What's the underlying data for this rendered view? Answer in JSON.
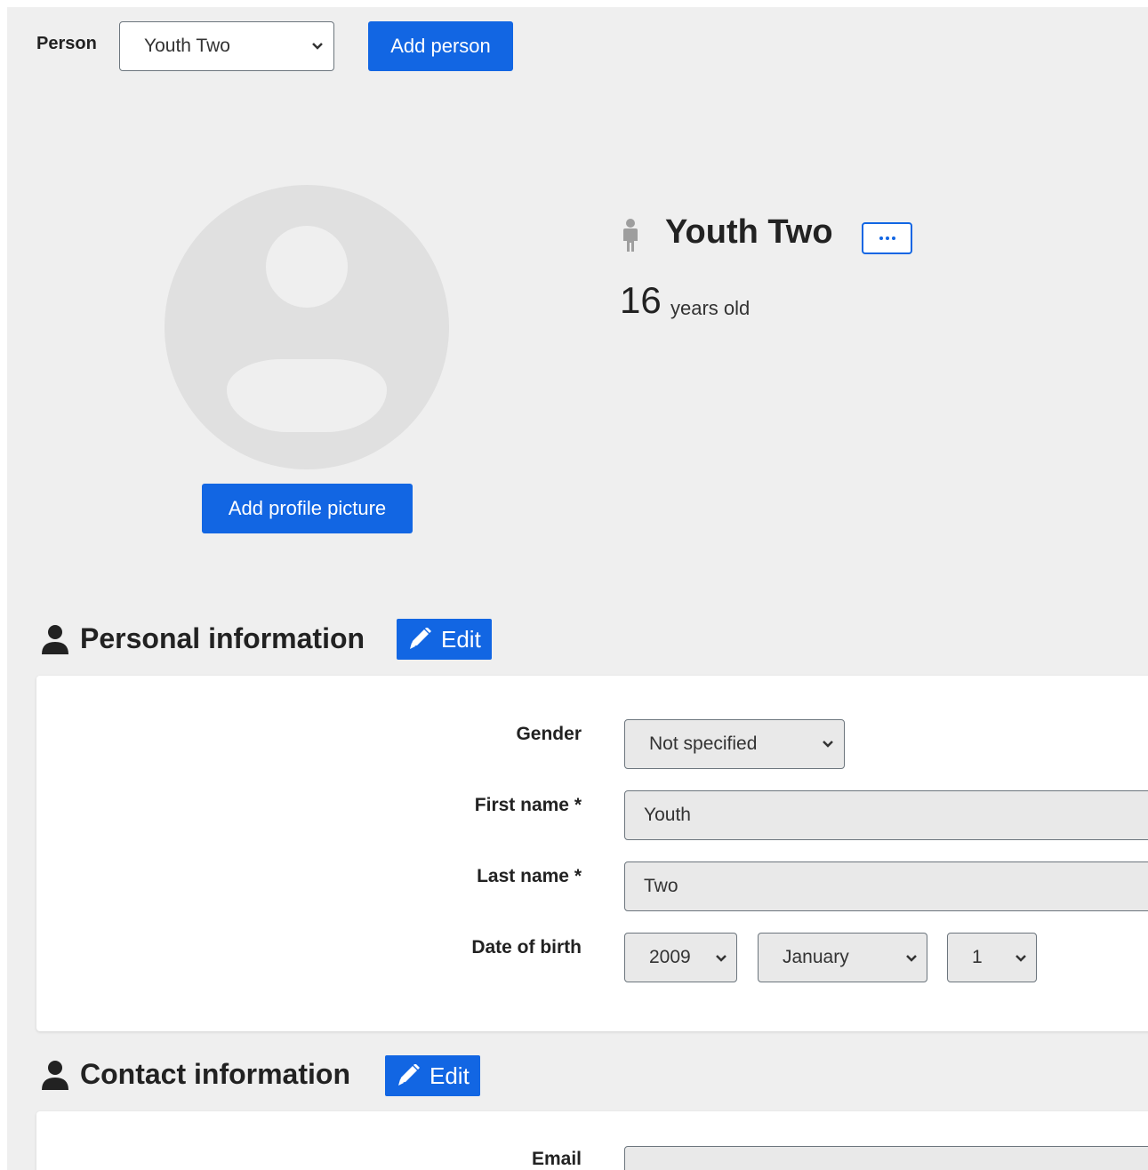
{
  "toolbar": {
    "person_label": "Person",
    "person_select_value": "Youth Two",
    "add_person_label": "Add person"
  },
  "profile": {
    "name": "Youth Two",
    "age_number": "16",
    "age_suffix": "years old",
    "add_picture_label": "Add profile picture",
    "person_icon": "child-icon",
    "more_icon": "ellipsis-icon"
  },
  "personal_information": {
    "title": "Personal information",
    "edit_label": "Edit",
    "section_icon": "user-icon",
    "edit_icon": "pencil-icon",
    "fields": {
      "gender_label": "Gender",
      "gender_value": "Not specified",
      "first_name_label": "First name *",
      "first_name_value": "Youth",
      "last_name_label": "Last name *",
      "last_name_value": "Two",
      "dob_label": "Date of birth",
      "dob_year": "2009",
      "dob_month": "January",
      "dob_day": "1"
    }
  },
  "contact_information": {
    "title": "Contact information",
    "edit_label": "Edit",
    "email_label": "Email"
  },
  "colors": {
    "accent": "#1266e3",
    "page_background": "#efefef",
    "avatar_placeholder": "#e0e0e0"
  }
}
